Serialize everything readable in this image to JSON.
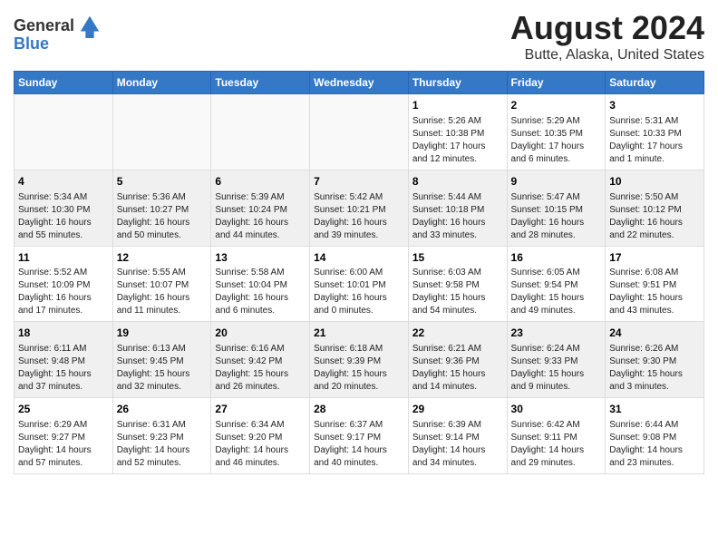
{
  "header": {
    "logo_line1": "General",
    "logo_line2": "Blue",
    "title": "August 2024",
    "subtitle": "Butte, Alaska, United States"
  },
  "weekdays": [
    "Sunday",
    "Monday",
    "Tuesday",
    "Wednesday",
    "Thursday",
    "Friday",
    "Saturday"
  ],
  "weeks": [
    {
      "days": [
        {
          "number": "",
          "content": ""
        },
        {
          "number": "",
          "content": ""
        },
        {
          "number": "",
          "content": ""
        },
        {
          "number": "",
          "content": ""
        },
        {
          "number": "1",
          "content": "Sunrise: 5:26 AM\nSunset: 10:38 PM\nDaylight: 17 hours\nand 12 minutes."
        },
        {
          "number": "2",
          "content": "Sunrise: 5:29 AM\nSunset: 10:35 PM\nDaylight: 17 hours\nand 6 minutes."
        },
        {
          "number": "3",
          "content": "Sunrise: 5:31 AM\nSunset: 10:33 PM\nDaylight: 17 hours\nand 1 minute."
        }
      ]
    },
    {
      "days": [
        {
          "number": "4",
          "content": "Sunrise: 5:34 AM\nSunset: 10:30 PM\nDaylight: 16 hours\nand 55 minutes."
        },
        {
          "number": "5",
          "content": "Sunrise: 5:36 AM\nSunset: 10:27 PM\nDaylight: 16 hours\nand 50 minutes."
        },
        {
          "number": "6",
          "content": "Sunrise: 5:39 AM\nSunset: 10:24 PM\nDaylight: 16 hours\nand 44 minutes."
        },
        {
          "number": "7",
          "content": "Sunrise: 5:42 AM\nSunset: 10:21 PM\nDaylight: 16 hours\nand 39 minutes."
        },
        {
          "number": "8",
          "content": "Sunrise: 5:44 AM\nSunset: 10:18 PM\nDaylight: 16 hours\nand 33 minutes."
        },
        {
          "number": "9",
          "content": "Sunrise: 5:47 AM\nSunset: 10:15 PM\nDaylight: 16 hours\nand 28 minutes."
        },
        {
          "number": "10",
          "content": "Sunrise: 5:50 AM\nSunset: 10:12 PM\nDaylight: 16 hours\nand 22 minutes."
        }
      ]
    },
    {
      "days": [
        {
          "number": "11",
          "content": "Sunrise: 5:52 AM\nSunset: 10:09 PM\nDaylight: 16 hours\nand 17 minutes."
        },
        {
          "number": "12",
          "content": "Sunrise: 5:55 AM\nSunset: 10:07 PM\nDaylight: 16 hours\nand 11 minutes."
        },
        {
          "number": "13",
          "content": "Sunrise: 5:58 AM\nSunset: 10:04 PM\nDaylight: 16 hours\nand 6 minutes."
        },
        {
          "number": "14",
          "content": "Sunrise: 6:00 AM\nSunset: 10:01 PM\nDaylight: 16 hours\nand 0 minutes."
        },
        {
          "number": "15",
          "content": "Sunrise: 6:03 AM\nSunset: 9:58 PM\nDaylight: 15 hours\nand 54 minutes."
        },
        {
          "number": "16",
          "content": "Sunrise: 6:05 AM\nSunset: 9:54 PM\nDaylight: 15 hours\nand 49 minutes."
        },
        {
          "number": "17",
          "content": "Sunrise: 6:08 AM\nSunset: 9:51 PM\nDaylight: 15 hours\nand 43 minutes."
        }
      ]
    },
    {
      "days": [
        {
          "number": "18",
          "content": "Sunrise: 6:11 AM\nSunset: 9:48 PM\nDaylight: 15 hours\nand 37 minutes."
        },
        {
          "number": "19",
          "content": "Sunrise: 6:13 AM\nSunset: 9:45 PM\nDaylight: 15 hours\nand 32 minutes."
        },
        {
          "number": "20",
          "content": "Sunrise: 6:16 AM\nSunset: 9:42 PM\nDaylight: 15 hours\nand 26 minutes."
        },
        {
          "number": "21",
          "content": "Sunrise: 6:18 AM\nSunset: 9:39 PM\nDaylight: 15 hours\nand 20 minutes."
        },
        {
          "number": "22",
          "content": "Sunrise: 6:21 AM\nSunset: 9:36 PM\nDaylight: 15 hours\nand 14 minutes."
        },
        {
          "number": "23",
          "content": "Sunrise: 6:24 AM\nSunset: 9:33 PM\nDaylight: 15 hours\nand 9 minutes."
        },
        {
          "number": "24",
          "content": "Sunrise: 6:26 AM\nSunset: 9:30 PM\nDaylight: 15 hours\nand 3 minutes."
        }
      ]
    },
    {
      "days": [
        {
          "number": "25",
          "content": "Sunrise: 6:29 AM\nSunset: 9:27 PM\nDaylight: 14 hours\nand 57 minutes."
        },
        {
          "number": "26",
          "content": "Sunrise: 6:31 AM\nSunset: 9:23 PM\nDaylight: 14 hours\nand 52 minutes."
        },
        {
          "number": "27",
          "content": "Sunrise: 6:34 AM\nSunset: 9:20 PM\nDaylight: 14 hours\nand 46 minutes."
        },
        {
          "number": "28",
          "content": "Sunrise: 6:37 AM\nSunset: 9:17 PM\nDaylight: 14 hours\nand 40 minutes."
        },
        {
          "number": "29",
          "content": "Sunrise: 6:39 AM\nSunset: 9:14 PM\nDaylight: 14 hours\nand 34 minutes."
        },
        {
          "number": "30",
          "content": "Sunrise: 6:42 AM\nSunset: 9:11 PM\nDaylight: 14 hours\nand 29 minutes."
        },
        {
          "number": "31",
          "content": "Sunrise: 6:44 AM\nSunset: 9:08 PM\nDaylight: 14 hours\nand 23 minutes."
        }
      ]
    }
  ]
}
